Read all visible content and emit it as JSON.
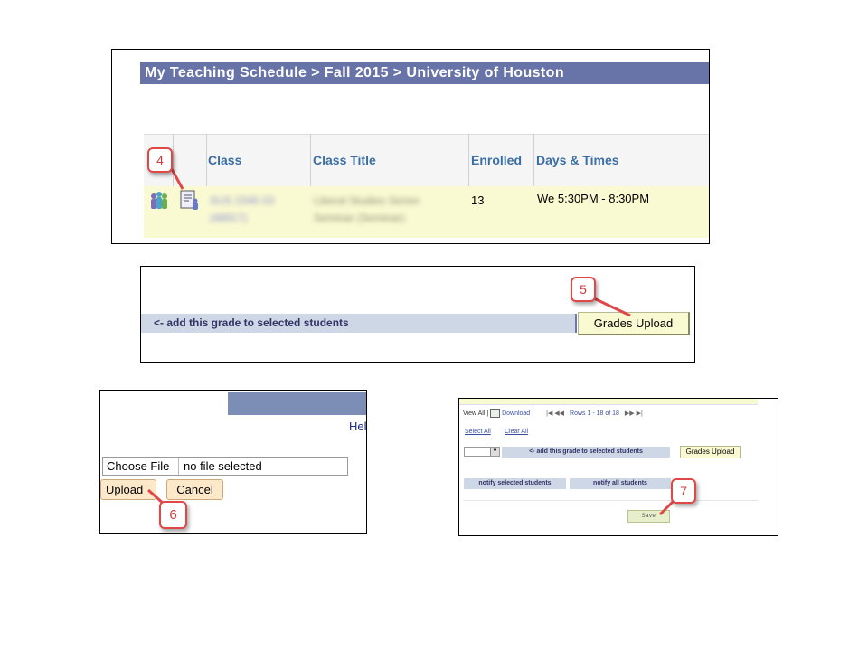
{
  "panel1": {
    "title": "My Teaching Schedule > Fall 2015 > University of Houston",
    "headers": {
      "class": "Class",
      "class_title": "Class Title",
      "enrolled": "Enrolled",
      "days_times": "Days & Times"
    },
    "row": {
      "class_line1": "SUS 2345 03",
      "class_line2": "(48917)",
      "title_line1": "Liberal Studies Senior",
      "title_line2": "Seminar (Seminar)",
      "enrolled": "13",
      "days_times": "We 5:30PM - 8:30PM"
    },
    "callout": "4"
  },
  "panel2": {
    "bar_text": "<- add this grade to selected students",
    "button": "Grades Upload",
    "callout": "5"
  },
  "panel3": {
    "help": "Hel",
    "choose_file": "Choose File",
    "no_file": "no file selected",
    "upload": "Upload",
    "cancel": "Cancel",
    "callout": "6"
  },
  "panel4": {
    "view_all": "View All |",
    "download": "Download",
    "rows": "Rows 1 - 18 of 18",
    "select_all": "Select All",
    "clear_all": "Clear All",
    "add_grade": "<- add this grade to selected students",
    "grades_upload": "Grades Upload",
    "notify_selected": "notify selected students",
    "notify_all": "notify all students",
    "save": "Save",
    "callout": "7"
  }
}
